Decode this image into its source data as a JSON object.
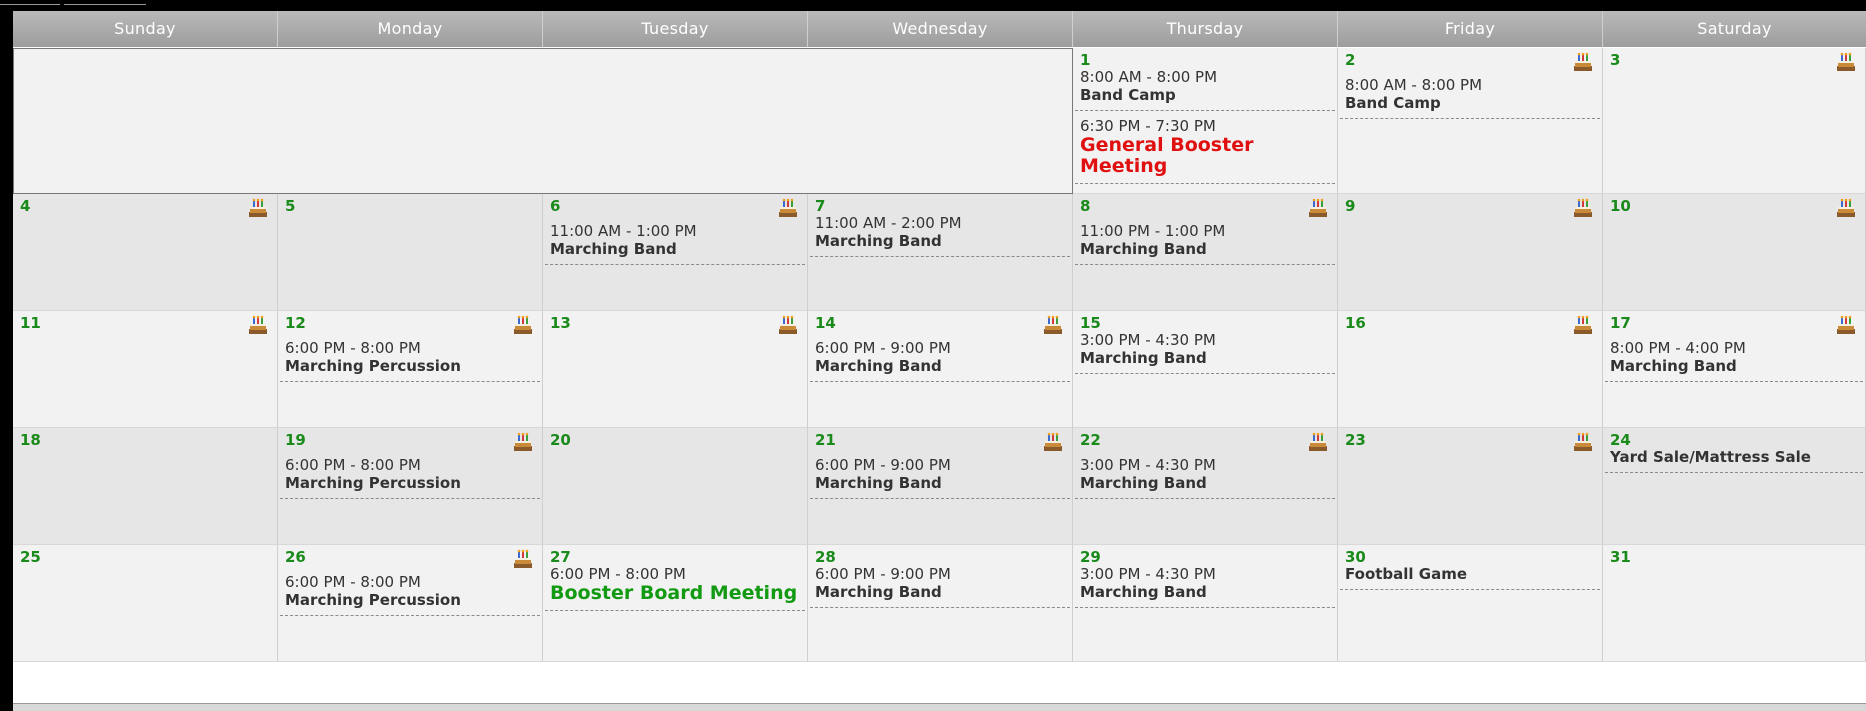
{
  "calendar": {
    "weekdays": [
      "Sunday",
      "Monday",
      "Tuesday",
      "Wednesday",
      "Thursday",
      "Friday",
      "Saturday"
    ],
    "weeks": [
      [
        null,
        null,
        null,
        null,
        {
          "day": "1",
          "cake": false,
          "events": [
            {
              "time": "8:00 AM - 8:00 PM",
              "title": "Band Camp",
              "style": "normal"
            },
            {
              "time": "6:30 PM - 7:30 PM",
              "title": "General Booster Meeting",
              "style": "red"
            }
          ]
        },
        {
          "day": "2",
          "cake": true,
          "events": [
            {
              "time": "8:00 AM - 8:00 PM",
              "title": "Band Camp",
              "style": "normal"
            }
          ]
        },
        {
          "day": "3",
          "cake": true,
          "events": []
        }
      ],
      [
        {
          "day": "4",
          "cake": true,
          "events": []
        },
        {
          "day": "5",
          "cake": false,
          "events": []
        },
        {
          "day": "6",
          "cake": true,
          "events": [
            {
              "time": "11:00 AM - 1:00 PM",
              "title": "Marching Band",
              "style": "normal"
            }
          ]
        },
        {
          "day": "7",
          "cake": false,
          "events": [
            {
              "time": "11:00 AM - 2:00 PM",
              "title": "Marching Band",
              "style": "normal"
            }
          ]
        },
        {
          "day": "8",
          "cake": true,
          "events": [
            {
              "time": "11:00 PM - 1:00 PM",
              "title": "Marching Band",
              "style": "normal"
            }
          ]
        },
        {
          "day": "9",
          "cake": true,
          "events": []
        },
        {
          "day": "10",
          "cake": true,
          "events": []
        }
      ],
      [
        {
          "day": "11",
          "cake": true,
          "events": []
        },
        {
          "day": "12",
          "cake": true,
          "events": [
            {
              "time": "6:00 PM - 8:00 PM",
              "title": "Marching Percussion",
              "style": "normal"
            }
          ]
        },
        {
          "day": "13",
          "cake": true,
          "events": []
        },
        {
          "day": "14",
          "cake": true,
          "events": [
            {
              "time": "6:00 PM - 9:00 PM",
              "title": "Marching Band",
              "style": "normal"
            }
          ]
        },
        {
          "day": "15",
          "cake": false,
          "events": [
            {
              "time": "3:00 PM - 4:30 PM",
              "title": "Marching Band",
              "style": "normal"
            }
          ]
        },
        {
          "day": "16",
          "cake": true,
          "events": []
        },
        {
          "day": "17",
          "cake": true,
          "events": [
            {
              "time": "8:00 PM - 4:00 PM",
              "title": "Marching Band",
              "style": "normal"
            }
          ]
        }
      ],
      [
        {
          "day": "18",
          "cake": false,
          "events": []
        },
        {
          "day": "19",
          "cake": true,
          "events": [
            {
              "time": "6:00 PM - 8:00 PM",
              "title": "Marching Percussion",
              "style": "normal"
            }
          ]
        },
        {
          "day": "20",
          "cake": false,
          "events": []
        },
        {
          "day": "21",
          "cake": true,
          "events": [
            {
              "time": "6:00 PM - 9:00 PM",
              "title": "Marching Band",
              "style": "normal"
            }
          ]
        },
        {
          "day": "22",
          "cake": true,
          "events": [
            {
              "time": "3:00 PM - 4:30 PM",
              "title": "Marching Band",
              "style": "normal"
            }
          ]
        },
        {
          "day": "23",
          "cake": true,
          "events": []
        },
        {
          "day": "24",
          "cake": false,
          "events": [
            {
              "time": "",
              "title": "Yard Sale/Mattress Sale",
              "style": "normal"
            }
          ]
        }
      ],
      [
        {
          "day": "25",
          "cake": false,
          "events": []
        },
        {
          "day": "26",
          "cake": true,
          "events": [
            {
              "time": "6:00 PM - 8:00 PM",
              "title": "Marching Percussion",
              "style": "normal"
            }
          ]
        },
        {
          "day": "27",
          "cake": false,
          "events": [
            {
              "time": "6:00 PM - 8:00 PM",
              "title": "Booster Board Meeting",
              "style": "green"
            }
          ]
        },
        {
          "day": "28",
          "cake": false,
          "events": [
            {
              "time": "6:00 PM - 9:00 PM",
              "title": "Marching Band",
              "style": "normal"
            }
          ]
        },
        {
          "day": "29",
          "cake": false,
          "events": [
            {
              "time": "3:00 PM - 4:30 PM",
              "title": "Marching Band",
              "style": "normal"
            }
          ]
        },
        {
          "day": "30",
          "cake": false,
          "events": [
            {
              "time": "",
              "title": "Football Game",
              "style": "normal"
            }
          ]
        },
        {
          "day": "31",
          "cake": false,
          "events": []
        }
      ]
    ]
  },
  "icons": {
    "cake": "birthday-cake-icon"
  },
  "colors": {
    "day_number": "#1a8a1a",
    "meeting_red": "#e01010",
    "meeting_green": "#139a13",
    "header": "#a9a9a9"
  }
}
